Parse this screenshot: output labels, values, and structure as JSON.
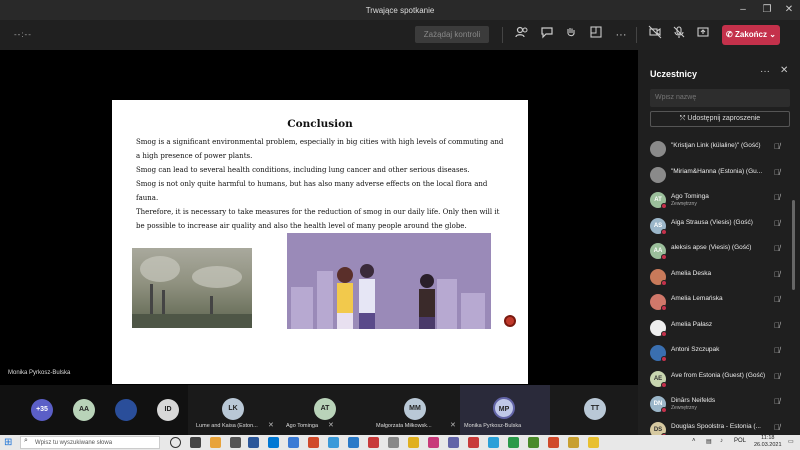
{
  "window": {
    "title": "Trwające spotkanie"
  },
  "toolbar": {
    "timer": "--:--",
    "control_label": "Zażądaj kontroli",
    "end_label": "Zakończ"
  },
  "slide": {
    "title": "Conclusion",
    "paragraphs": [
      "Smog is a significant environmental problem, especially in big cities with high levels of commuting and a high presence of power plants.",
      "Smog can lead to several health conditions, including lung cancer and other serious diseases.",
      "Smog is not only quite harmful to humans, but has also many adverse effects on the local flora and fauna.",
      "Therefore, it is necessary to take measures for the reduction of smog in our daily life. Only then will it be possible to increase air quality and also the health level of many people around the globe."
    ]
  },
  "presenter": {
    "name": "Monika Pyrkosz-Bulska"
  },
  "participants": {
    "title": "Uczestnicy",
    "search_placeholder": "Wpisz nazwę",
    "share_label": "Udostępnij zaproszenie",
    "list": [
      {
        "name": "\"Kristjan Link (külaline)\" (Gość)",
        "initials": "",
        "color": "#8a8a8a",
        "sub": ""
      },
      {
        "name": "\"Miriam&Hanna (Estonia) (Gu...",
        "initials": "",
        "color": "#8a8a8a",
        "sub": ""
      },
      {
        "name": "Ago Tominga",
        "initials": "AT",
        "color": "#9bbf9b",
        "sub": "Zewnętrzny"
      },
      {
        "name": "Aiga Štrausa (Viesis) (Gość)",
        "initials": "AS",
        "color": "#9bb6c9",
        "sub": ""
      },
      {
        "name": "aleksis apse (Viesis) (Gość)",
        "initials": "AA",
        "color": "#9bbf9b",
        "sub": ""
      },
      {
        "name": "Amelia Deska",
        "initials": "",
        "color": "#c87a5a",
        "sub": ""
      },
      {
        "name": "Amelia Lemańska",
        "initials": "",
        "color": "#d0786a",
        "sub": ""
      },
      {
        "name": "Amelia Pałasz",
        "initials": "",
        "color": "#eeeeee",
        "sub": ""
      },
      {
        "name": "Antoni Szczupak",
        "initials": "",
        "color": "#3a6fb0",
        "sub": ""
      },
      {
        "name": "Ave from Estonia (Guest) (Gość)",
        "initials": "AE",
        "color": "#c8d6b0",
        "sub": ""
      },
      {
        "name": "Dinārs Neifelds",
        "initials": "DN",
        "color": "#9bb6c9",
        "sub": "Zewnętrzny"
      },
      {
        "name": "Douglas Spoolstra - Estonia (...",
        "initials": "DS",
        "color": "#d6c9a0",
        "sub": ""
      }
    ]
  },
  "gallery": {
    "overflow_count": "+35",
    "tiles": [
      {
        "initials": "AA",
        "color": "#b9d3b9",
        "name": ""
      },
      {
        "initials": "",
        "color": "#2a4e9a",
        "name": ""
      },
      {
        "initials": "ID",
        "color": "#d8d8d8",
        "name": ""
      },
      {
        "initials": "LK",
        "color": "#b9c8d6",
        "name": "Lume and Kaisa (Eston..."
      },
      {
        "initials": "AT",
        "color": "#b9d3b9",
        "name": "Ago Tominga"
      },
      {
        "initials": "MM",
        "color": "#b9c8d6",
        "name": "Małgorzata Miłkowsk..."
      },
      {
        "initials": "MP",
        "color": "#c0c8e8",
        "name": "Monika Pyrkosz-Bulska"
      },
      {
        "initials": "TT",
        "color": "#b9c8d6",
        "name": ""
      }
    ]
  },
  "taskbar": {
    "search_placeholder": "Wpisz tu wyszukiwane słowa",
    "lang": "POL",
    "time": "11:18",
    "date": "26.03.2021"
  }
}
